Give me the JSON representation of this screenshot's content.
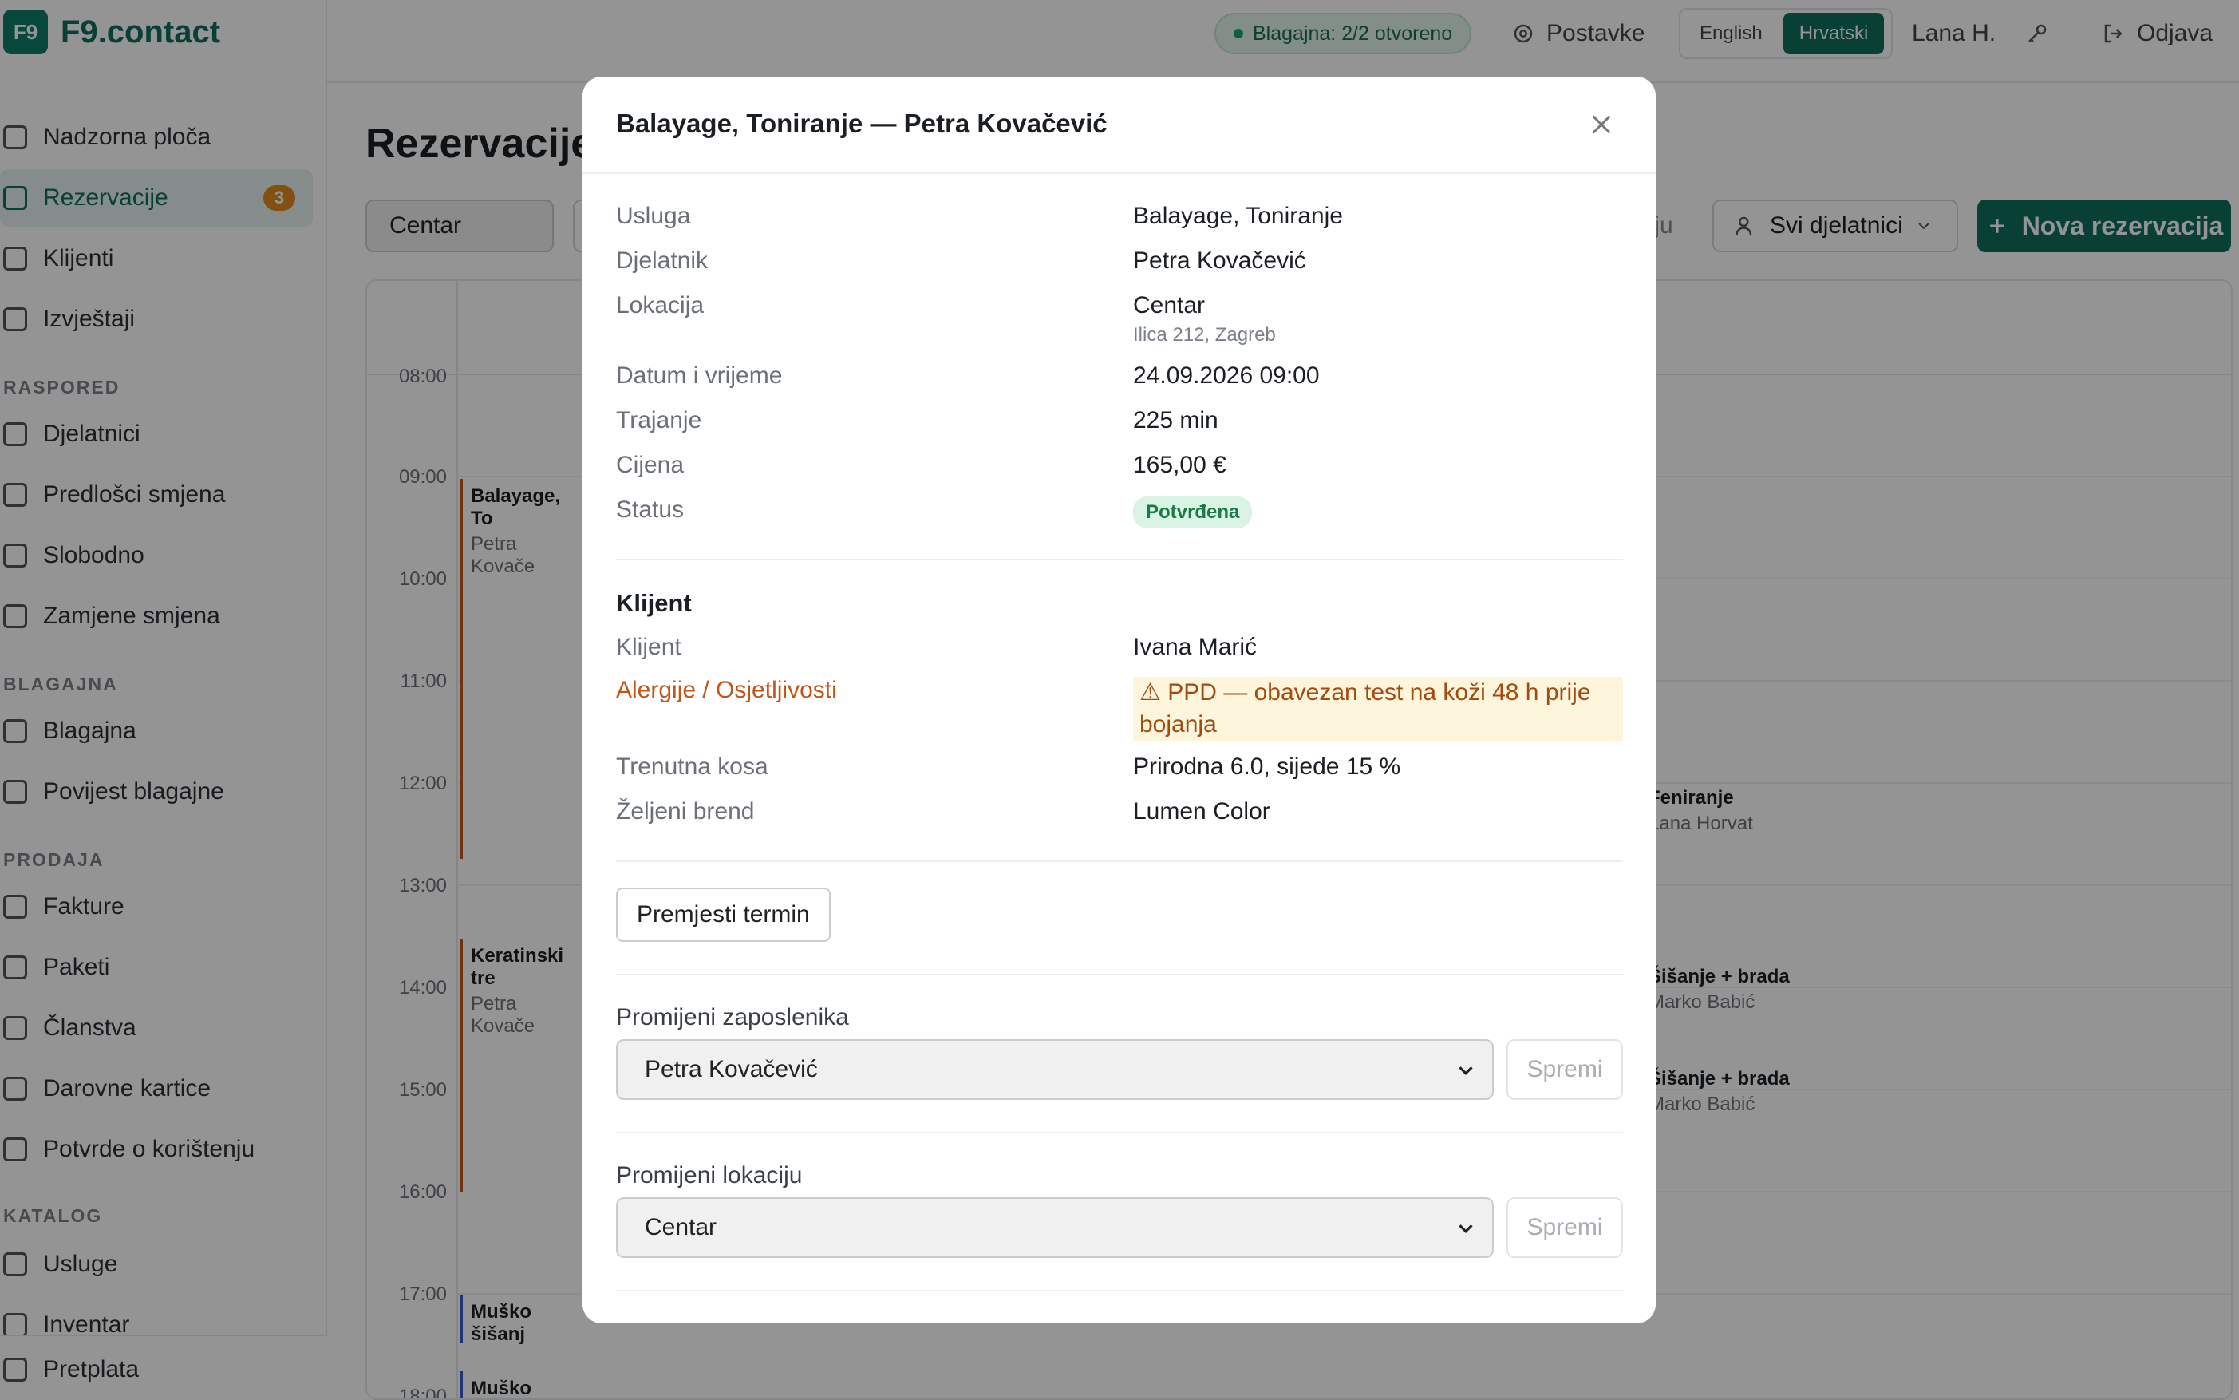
{
  "app": {
    "logo_mark": "F9",
    "name": "F9.contact"
  },
  "sidebar": {
    "items": [
      {
        "label": "Nadzorna ploča",
        "icon": "grid-icon"
      },
      {
        "label": "Rezervacije",
        "icon": "calendar-icon",
        "badge": "3"
      },
      {
        "label": "Klijenti",
        "icon": "users-icon"
      },
      {
        "label": "Izvještaji",
        "icon": "bar-chart-icon"
      },
      {
        "label": "Djelatnici",
        "icon": "user-cog-icon"
      },
      {
        "label": "Predlošci smjena",
        "icon": "calendar-grid-icon"
      },
      {
        "label": "Slobodno",
        "icon": "calendar-x-icon"
      },
      {
        "label": "Zamjene smjena",
        "icon": "swap-icon"
      },
      {
        "label": "Blagajna",
        "icon": "cash-icon"
      },
      {
        "label": "Povijest blagajne",
        "icon": "history-icon"
      },
      {
        "label": "Fakture",
        "icon": "invoice-icon"
      },
      {
        "label": "Paketi",
        "icon": "package-icon"
      },
      {
        "label": "Članstva",
        "icon": "award-icon"
      },
      {
        "label": "Darovne kartice",
        "icon": "gift-icon"
      },
      {
        "label": "Potvrde o korištenju",
        "icon": "document-icon"
      },
      {
        "label": "Usluge",
        "icon": "scissors-icon"
      },
      {
        "label": "Inventar",
        "icon": "box-icon"
      },
      {
        "label": "Pretplata",
        "icon": "card-icon"
      }
    ],
    "sections": {
      "raspored": "RASPORED",
      "blagajna": "BLAGAJNA",
      "prodaja": "PRODAJA",
      "katalog": "KATALOG"
    }
  },
  "topbar": {
    "register_status": "Blagajna: 2/2 otvoreno",
    "settings": "Postavke",
    "lang_en": "English",
    "lang_hr": "Hrvatski",
    "user": "Lana H.",
    "logout": "Odjava"
  },
  "page": {
    "title": "Rezervacije",
    "location_filter": "Centar",
    "partial_label": "anju",
    "staff_filter": "Svi djelatnici",
    "new_button": "Nova rezervacija"
  },
  "calendar": {
    "times": [
      "08:00",
      "09:00",
      "10:00",
      "11:00",
      "12:00",
      "13:00",
      "14:00",
      "15:00",
      "16:00",
      "17:00",
      "18:00"
    ],
    "events_left": [
      {
        "title": "Balayage, To",
        "sub": "Petra Kovače"
      },
      {
        "title": "Keratinski tre",
        "sub": "Petra Kovače"
      },
      {
        "title": "Muško šišanj",
        "sub": ""
      },
      {
        "title": "Muško šišanje",
        "sub": ""
      }
    ],
    "events_right": [
      {
        "title": "Feniranje",
        "sub": "Lana Horvat"
      },
      {
        "title": "Šišanje + brada",
        "sub": "Marko Babić"
      },
      {
        "title": "Šišanje + brada",
        "sub": "Marko Babić"
      }
    ]
  },
  "modal": {
    "title": "Balayage, Toniranje — Petra Kovačević",
    "details": {
      "service_label": "Usluga",
      "service": "Balayage, Toniranje",
      "staff_label": "Djelatnik",
      "staff": "Petra Kovačević",
      "location_label": "Lokacija",
      "location": "Centar",
      "address": "Ilica 212, Zagreb",
      "datetime_label": "Datum i vrijeme",
      "datetime": "24.09.2026 09:00",
      "duration_label": "Trajanje",
      "duration": "225 min",
      "price_label": "Cijena",
      "price": "165,00 €",
      "status_label": "Status",
      "status": "Potvrđena"
    },
    "client": {
      "section_title": "Klijent",
      "client_label": "Klijent",
      "client": "Ivana Marić",
      "allergy_label": "Alergije / Osjetljivosti",
      "allergy": "⚠ PPD — obavezan test na koži 48 h prije bojanja",
      "hair_label": "Trenutna kosa",
      "hair": "Prirodna 6.0, sijede 15 %",
      "brand_label": "Željeni brend",
      "brand": "Lumen Color"
    },
    "move_button": "Premjesti termin",
    "change_staff_label": "Promijeni zaposlenika",
    "change_staff_value": "Petra Kovačević",
    "change_location_label": "Promijeni lokaciju",
    "change_location_value": "Centar",
    "save_label": "Spremi"
  }
}
